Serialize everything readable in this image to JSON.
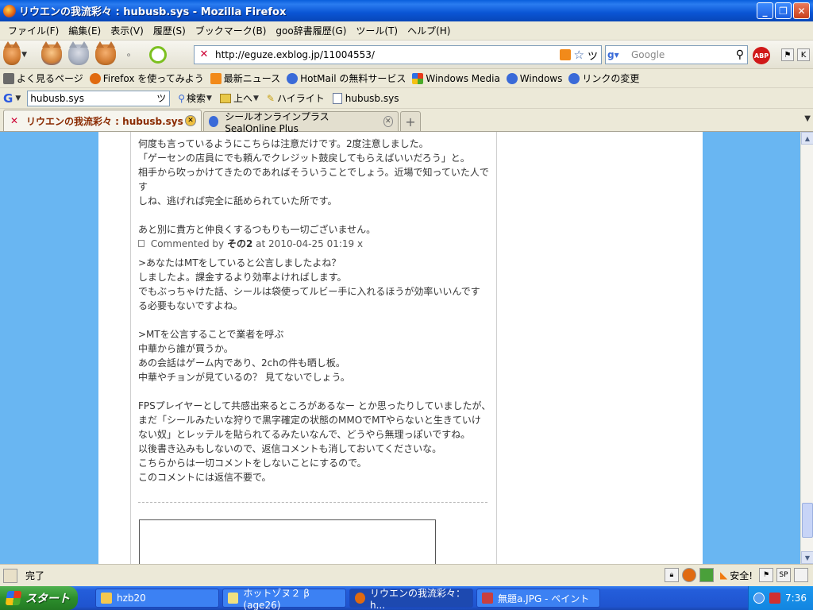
{
  "window": {
    "title": "リウエンの我流彩々 : hubusb.sys - Mozilla Firefox",
    "buttons": {
      "minimize": "_",
      "restore": "❐",
      "close": "✕"
    }
  },
  "menu": [
    "ファイル(F)",
    "編集(E)",
    "表示(V)",
    "履歴(S)",
    "ブックマーク(B)",
    "goo辞書履歴(G)",
    "ツール(T)",
    "ヘルプ(H)"
  ],
  "nav": {
    "url": "http://eguze.exblog.jp/11004553/",
    "search_placeholder": "Google",
    "abp_label": "ABP"
  },
  "bookmarks": [
    {
      "label": "よく見るページ",
      "icon": "page-icon",
      "color": "#6a6a6a"
    },
    {
      "label": "Firefox を使ってみよう",
      "icon": "firefox-icon",
      "color": "#e06a10"
    },
    {
      "label": "最新ニュース",
      "icon": "rss-icon",
      "color": "#f28a1a"
    },
    {
      "label": "HotMail の無料サービス",
      "icon": "globe-icon",
      "color": "#3a6ad8"
    },
    {
      "label": "Windows Media",
      "icon": "windows-icon",
      "color": "#e0a020"
    },
    {
      "label": "Windows",
      "icon": "globe-icon",
      "color": "#3a6ad8"
    },
    {
      "label": "リンクの変更",
      "icon": "globe-icon",
      "color": "#3a6ad8"
    }
  ],
  "gbar": {
    "logo": "G",
    "query": "hubusb.sys",
    "search_label": "検索",
    "up_label": "上へ",
    "highlight_label": "ハイライト",
    "term": "hubusb.sys"
  },
  "tabs": [
    {
      "label": "リウエンの我流彩々 : hubusb.sys",
      "active": true
    },
    {
      "label": "シールオンラインプラス SealOnline Plus",
      "active": false
    }
  ],
  "content": {
    "comment1_lines": [
      "何度も言っているようにこちらは注意だけです。2度注意しました。",
      "「ゲーセンの店員にでも頼んでクレジット鼓戻してもらえばいいだろう」と。",
      "相手から吹っかけてきたのであればそういうことでしょう。近場で知っていた人です",
      "しね、逃げれば完全に舐められていた所です。",
      "",
      "あと別に貴方と仲良くするつもりも一切ございません。"
    ],
    "commented_prefix": "Commented by",
    "commented_author": "その2",
    "commented_suffix": "at 2010-04-25 01:19 x",
    "comment2_lines": [
      ">あなたはMTをしていると公言しましたよね？",
      "しましたよ。課金するより効率よければします。",
      "でもぶっちゃけた話、シールは袋使ってルビー手に入れるほうが効率いいんです",
      "る必要もないですよね。",
      "",
      ">MTを公言することで業者を呼ぶ",
      "中華から誰が買うか。",
      "あの会話はゲーム内であり、2chの件も晒し板。",
      "中華やチョンが見ているの？ 見てないでしょう。",
      "",
      "FPSプレイヤーとして共感出来るところがあるなー とか思ったりしていましたが、",
      "まだ「シールみたいな狩りで黒字確定の状態のMMOでMTやらないと生きていけ",
      "ない奴」とレッテルを貼られてるみたいなんで、どうやら無理っぽいですね。",
      "以後書き込みもしないので、返信コメントも消しておいてくださいな。",
      "こちらからは一切コメントをしないことにするので。",
      "このコメントには返信不要で。"
    ]
  },
  "status": {
    "text": "完了",
    "safe_label": "安全!",
    "sp_label": "SP"
  },
  "taskbar": {
    "start_label": "スタート",
    "tasks": [
      {
        "label": "hzb20",
        "icon": "folder-icon",
        "color": "#f4c850"
      },
      {
        "label": "ホットゾヌ２ β (age26)",
        "icon": "app-icon",
        "color": "#f0e080"
      },
      {
        "label": "リウエンの我流彩々：h...",
        "icon": "firefox-icon",
        "color": "#e06a10",
        "active": true
      },
      {
        "label": "無題a.JPG - ペイント",
        "icon": "paint-icon",
        "color": "#c84040"
      }
    ],
    "clock": "7:36"
  },
  "colors": {
    "page_bg": "#69b6f2",
    "titlebar": "#0a55d4",
    "taskbar": "#245edb",
    "start": "#2d8f2d"
  }
}
